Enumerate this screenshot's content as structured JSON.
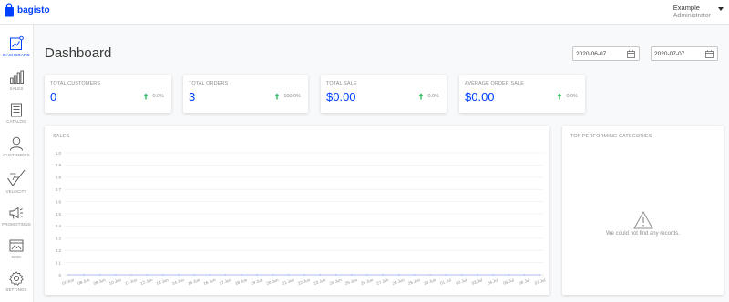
{
  "header": {
    "brand": "bagisto",
    "user_name": "Example",
    "user_role": "Administrator"
  },
  "sidebar": {
    "items": [
      {
        "label": "DASHBOARD",
        "icon": "dashboard-icon",
        "active": true
      },
      {
        "label": "SALES",
        "icon": "sales-icon"
      },
      {
        "label": "CATALOG",
        "icon": "catalog-icon"
      },
      {
        "label": "CUSTOMERS",
        "icon": "customers-icon"
      },
      {
        "label": "VELOCITY",
        "icon": "velocity-icon"
      },
      {
        "label": "PROMOTIONS",
        "icon": "promotions-icon"
      },
      {
        "label": "CMS",
        "icon": "cms-icon"
      },
      {
        "label": "SETTINGS",
        "icon": "settings-icon"
      }
    ]
  },
  "main": {
    "title": "Dashboard",
    "date_start": "2020-06-07",
    "date_end": "2020-07-07",
    "stats": [
      {
        "label": "TOTAL CUSTOMERS",
        "value": "0",
        "change": "0.0%"
      },
      {
        "label": "TOTAL ORDERS",
        "value": "3",
        "change": "100.0%"
      },
      {
        "label": "TOTAL SALE",
        "value": "$0.00",
        "change": "0.0%"
      },
      {
        "label": "AVERAGE ORDER SALE",
        "value": "$0.00",
        "change": "0.0%"
      }
    ],
    "sales_panel_title": "SALES",
    "categories_panel_title": "TOP PERFORMING CATEGORIES",
    "categories_empty_text": "We could not find any records."
  },
  "colors": {
    "accent": "#0041ff",
    "positive": "#2ebd5f",
    "muted_text": "#8e8e8e"
  },
  "chart_data": {
    "type": "line",
    "title": "SALES",
    "ylim": [
      0,
      1
    ],
    "yticks": [
      "0",
      "0.1",
      "0.2",
      "0.3",
      "0.4",
      "0.5",
      "0.6",
      "0.7",
      "0.8",
      "0.9",
      "1.0"
    ],
    "categories": [
      "07 Jun",
      "08 Jun",
      "09 Jun",
      "10 Jun",
      "11 Jun",
      "12 Jun",
      "13 Jun",
      "14 Jun",
      "15 Jun",
      "16 Jun",
      "17 Jun",
      "18 Jun",
      "19 Jun",
      "20 Jun",
      "21 Jun",
      "22 Jun",
      "23 Jun",
      "24 Jun",
      "25 Jun",
      "26 Jun",
      "27 Jun",
      "28 Jun",
      "29 Jun",
      "30 Jun",
      "01 Jul",
      "02 Jul",
      "03 Jul",
      "04 Jul",
      "05 Jul",
      "06 Jul",
      "07 Jul"
    ],
    "series": [
      {
        "values": [
          0,
          0,
          0,
          0,
          0,
          0,
          0,
          0,
          0,
          0,
          0,
          0,
          0,
          0,
          0,
          0,
          0,
          0,
          0,
          0,
          0,
          0,
          0,
          0,
          0,
          0,
          0,
          0,
          0,
          0,
          0
        ]
      }
    ],
    "grid": true
  }
}
